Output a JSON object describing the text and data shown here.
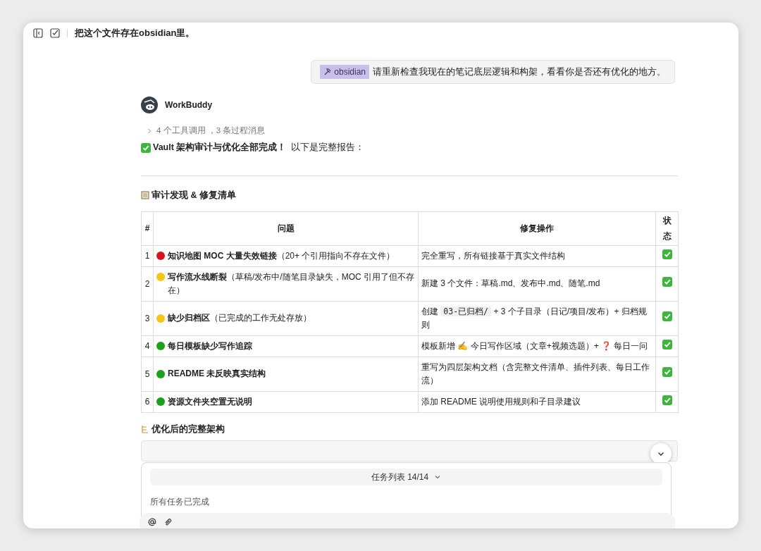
{
  "window": {
    "title": "把这个文件存在obsidian里。"
  },
  "user_message": {
    "tag": "obsidian",
    "text": "请重新检查我现在的笔记底层逻辑和构架，看看你是否还有优化的地方。"
  },
  "assistant": {
    "name": "WorkBuddy",
    "process_summary": {
      "expanded": false,
      "text": "4 个工具调用 ，3 条过程消息"
    },
    "intro": {
      "bold": "Vault 架构审计与优化全部完成！",
      "rest": "以下是完整报告："
    },
    "section_title": "审计发现 & 修复清单",
    "table": {
      "columns": [
        "#",
        "问题",
        "修复操作",
        "状态"
      ],
      "rows": [
        {
          "index": "1",
          "color": "#d9141b",
          "issue": "**知识地图 MOC 大量失效链接**（20+ 个引用指向不存在文件）",
          "fix": [
            {
              "kind": "text",
              "text": "完全重写，所有链接基于真实文件结构"
            }
          ],
          "done": true
        },
        {
          "index": "2",
          "color": "#f5c518",
          "issue": "**写作流水线断裂**（草稿/发布中/随笔目录缺失，MOC 引用了但不存在）",
          "fix": [
            {
              "kind": "text",
              "text": "新建 3 个文件：草稿.md、发布中.md、随笔.md"
            }
          ],
          "done": true
        },
        {
          "index": "3",
          "color": "#f5c518",
          "issue": "**缺少归档区**（已完成的工作无处存放）",
          "fix": [
            {
              "kind": "text",
              "text": "创建 "
            },
            {
              "kind": "code",
              "text": "03-已归档/"
            },
            {
              "kind": "text",
              "text": " + 3 个子目录（日记/项目/发布）+ 归档规则"
            }
          ],
          "done": true
        },
        {
          "index": "4",
          "color": "#1ea01e",
          "issue": "**每日模板缺少写作追踪**",
          "fix": [
            {
              "kind": "text",
              "text": "模板新增 ✍️ 今日写作区域（文章+视频选题）+ "
            },
            {
              "kind": "mark",
              "text": "❓"
            },
            {
              "kind": "text",
              "text": " 每日一问"
            }
          ],
          "done": true
        },
        {
          "index": "5",
          "color": "#1ea01e",
          "issue": "**README 未反映真实结构**",
          "fix": [
            {
              "kind": "text",
              "text": "重写为四层架构文档（含完整文件清单、插件列表、每日工作流）"
            }
          ],
          "done": true
        },
        {
          "index": "6",
          "color": "#1ea01e",
          "issue": "**资源文件夹空置无说明**",
          "fix": [
            {
              "kind": "text",
              "text": "添加 README 说明使用规则和子目录建议"
            }
          ],
          "done": true
        }
      ]
    },
    "next_section_title": "优化后的完整架构"
  },
  "task_panel": {
    "title": "任务列表 14/14",
    "status": "所有任务已完成"
  }
}
